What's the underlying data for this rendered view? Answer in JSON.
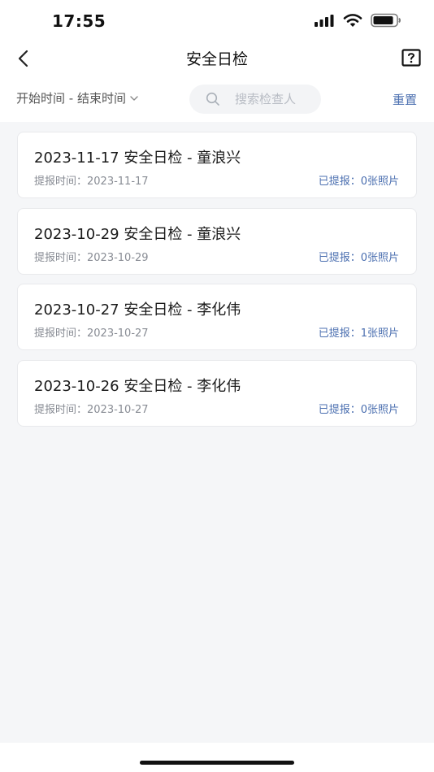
{
  "status_bar": {
    "time": "17:55",
    "icons": [
      "signal-icon",
      "wifi-icon",
      "battery-icon"
    ]
  },
  "nav": {
    "title": "安全日检",
    "back_icon": "chevron-left-icon",
    "help_icon": "help-box-icon"
  },
  "filter": {
    "date_range_label": "开始时间 - 结束时间",
    "dropdown_icon": "chevron-down-icon",
    "search_placeholder": "搜索检查人",
    "search_value": "",
    "reset_label": "重置"
  },
  "records": [
    {
      "title": "2023-11-17 安全日检 - 童浪兴",
      "time": "提报时间：2023-11-17",
      "photos": "已提报：0张照片"
    },
    {
      "title": "2023-10-29 安全日检 - 童浪兴",
      "time": "提报时间：2023-10-29",
      "photos": "已提报：0张照片"
    },
    {
      "title": "2023-10-27 安全日检 - 李化伟",
      "time": "提报时间：2023-10-27",
      "photos": "已提报：1张照片"
    },
    {
      "title": "2023-10-26 安全日检 - 李化伟",
      "time": "提报时间：2023-10-27",
      "photos": "已提报：0张照片"
    }
  ],
  "colors": {
    "accent": "#4b6fb0",
    "background": "#f5f6f8",
    "card": "#ffffff"
  }
}
